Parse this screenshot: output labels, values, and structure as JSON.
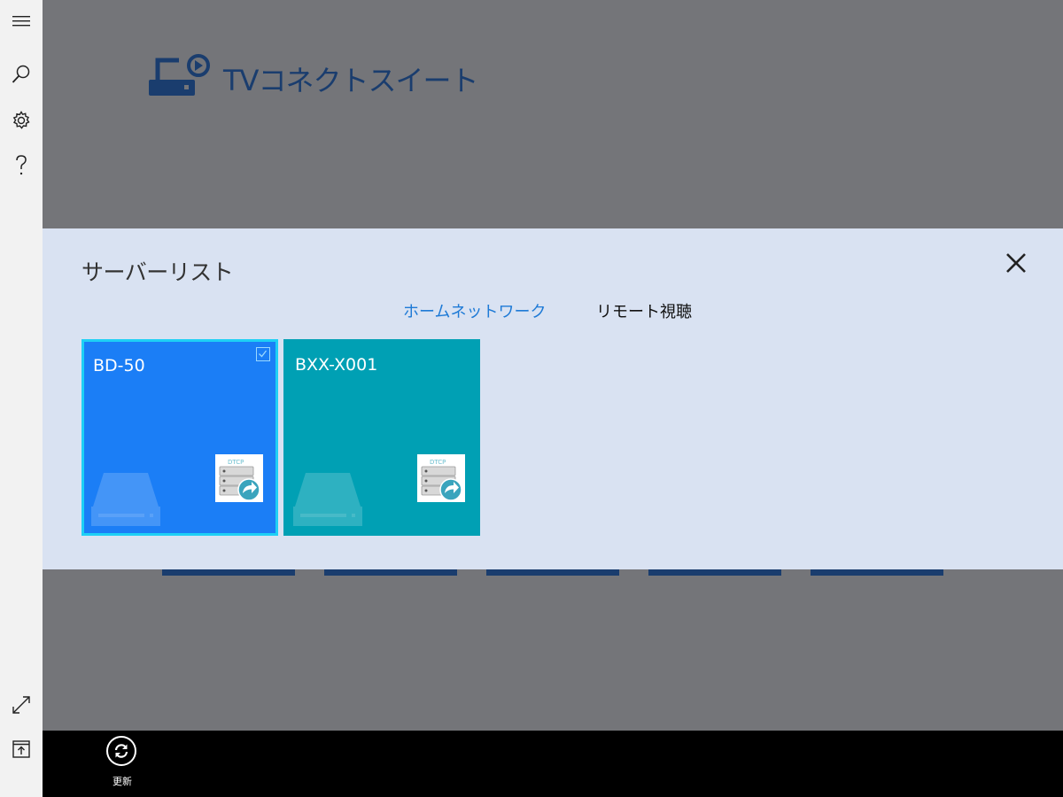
{
  "app": {
    "title": "TVコネクトスイート"
  },
  "sidebar": {
    "items": [
      {
        "icon": "hamburger-menu-icon"
      },
      {
        "icon": "search-icon"
      },
      {
        "icon": "gear-icon"
      },
      {
        "icon": "help-icon"
      },
      {
        "icon": "expand-icon"
      },
      {
        "icon": "upload-icon"
      }
    ]
  },
  "server_list": {
    "title": "サーバーリスト",
    "tabs": [
      {
        "label": "ホームネットワーク",
        "active": true
      },
      {
        "label": "リモート視聴",
        "active": false
      }
    ],
    "servers": [
      {
        "name": "BD-50",
        "selected": true,
        "color": "#1b7ef6"
      },
      {
        "name": "BXX-X001",
        "selected": false,
        "color": "#00a0b4"
      }
    ],
    "badge_text": "DTCP"
  },
  "bottom_bar": {
    "refresh_label": "更新"
  },
  "colors": {
    "accent": "#1e7ad6",
    "panel_bg": "#d9e2f2",
    "selection_border": "#1ed0f5"
  }
}
